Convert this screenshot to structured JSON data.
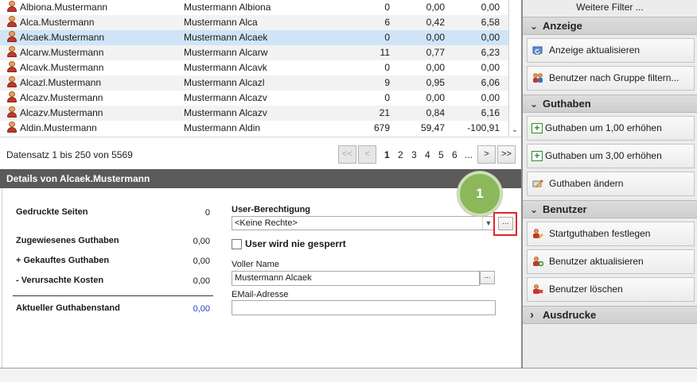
{
  "table": {
    "rows": [
      {
        "username": "Albiona.Mustermann",
        "fullname": "Mustermann Albiona",
        "pages": "0",
        "credit": "0,00",
        "balance": "0,00",
        "selected": false
      },
      {
        "username": "Alca.Mustermann",
        "fullname": "Mustermann Alca",
        "pages": "6",
        "credit": "0,42",
        "balance": "6,58",
        "selected": false
      },
      {
        "username": "Alcaek.Mustermann",
        "fullname": "Mustermann Alcaek",
        "pages": "0",
        "credit": "0,00",
        "balance": "0,00",
        "selected": true
      },
      {
        "username": "Alcarw.Mustermann",
        "fullname": "Mustermann Alcarw",
        "pages": "11",
        "credit": "0,77",
        "balance": "6,23",
        "selected": false
      },
      {
        "username": "Alcavk.Mustermann",
        "fullname": "Mustermann Alcavk",
        "pages": "0",
        "credit": "0,00",
        "balance": "0,00",
        "selected": false
      },
      {
        "username": "Alcazl.Mustermann",
        "fullname": "Mustermann Alcazl",
        "pages": "9",
        "credit": "0,95",
        "balance": "6,06",
        "selected": false
      },
      {
        "username": "Alcazv.Mustermann",
        "fullname": "Mustermann Alcazv",
        "pages": "0",
        "credit": "0,00",
        "balance": "0,00",
        "selected": false
      },
      {
        "username": "Alcazv.Mustermann",
        "fullname": "Mustermann Alcazv",
        "pages": "21",
        "credit": "0,84",
        "balance": "6,16",
        "selected": false
      },
      {
        "username": "Aldin.Mustermann",
        "fullname": "Mustermann Aldin",
        "pages": "679",
        "credit": "59,47",
        "balance": "-100,91",
        "selected": false
      }
    ],
    "scroll_down_glyph": "⌄"
  },
  "paging": {
    "record_info": "Datensatz 1 bis 250 von 5569",
    "first_label": "<<",
    "prev_label": "<",
    "pages": [
      "1",
      "2",
      "3",
      "4",
      "5",
      "6",
      "..."
    ],
    "current_page": "1",
    "next_label": ">",
    "last_label": ">>"
  },
  "details": {
    "title": "Details von Alcaek.Mustermann",
    "printed_pages_label": "Gedruckte Seiten",
    "printed_pages_value": "0",
    "assigned_credit_label": "Zugewiesenes Guthaben",
    "assigned_credit_value": "0,00",
    "bought_credit_label": "+ Gekauftes Guthaben",
    "bought_credit_value": "0,00",
    "caused_costs_label": "- Verursachte Kosten",
    "caused_costs_value": "0,00",
    "current_balance_label": "Aktueller Guthabenstand",
    "current_balance_value": "0,00",
    "current_balance_color": "#1f3fbf",
    "permission_label": "User-Berechtigung",
    "permission_value": "<Keine Rechte>",
    "dots_label": "...",
    "never_locked_label": "User wird nie gesperrt",
    "never_locked_checked": false,
    "fullname_label": "Voller Name",
    "fullname_value": "Mustermann Alcaek",
    "email_label": "EMail-Adresse",
    "email_value": ""
  },
  "callout": {
    "number": "1",
    "color": "#8cb75a"
  },
  "sidebar": {
    "more_filters": "Weitere Filter ...",
    "sections": {
      "anzeige": {
        "title": "Anzeige",
        "chevron": "⌄",
        "buttons": [
          "Anzeige aktualisieren",
          "Benutzer nach Gruppe filtern..."
        ]
      },
      "guthaben": {
        "title": "Guthaben",
        "chevron": "⌄",
        "buttons": [
          "Guthaben um 1,00 erhöhen",
          "Guthaben um 3,00 erhöhen",
          "Guthaben ändern"
        ]
      },
      "benutzer": {
        "title": "Benutzer",
        "chevron": "⌄",
        "buttons": [
          "Startguthaben festlegen",
          "Benutzer aktualisieren",
          "Benutzer löschen"
        ]
      },
      "ausdrucke": {
        "title": "Ausdrucke",
        "chevron": "›"
      }
    }
  },
  "colors": {
    "selection": "#cfe5f7",
    "details_header": "#5a5a5a",
    "highlight_box": "#e0262b"
  }
}
